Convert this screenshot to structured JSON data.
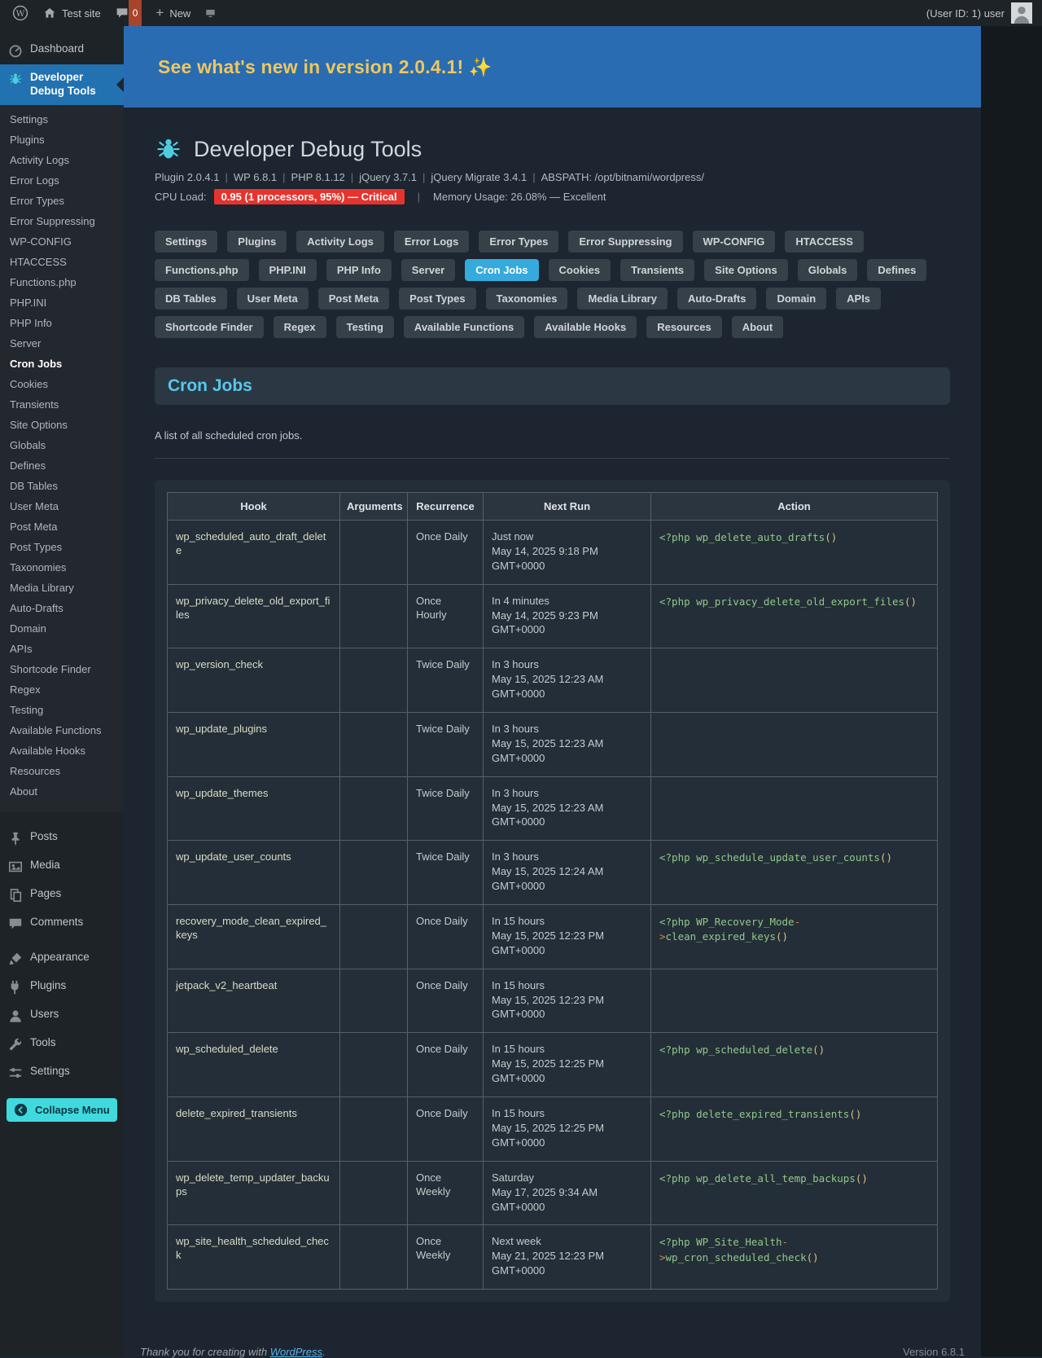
{
  "admin_bar": {
    "site_name": "Test site",
    "comments_count": "0",
    "new_label": "New",
    "user_info": "(User ID: 1) user"
  },
  "sidebar": {
    "dashboard_label": "Dashboard",
    "plugin_label": "Developer Debug Tools",
    "submenu_active": "Cron Jobs",
    "submenu": [
      "Settings",
      "Plugins",
      "Activity Logs",
      "Error Logs",
      "Error Types",
      "Error Suppressing",
      "WP-CONFIG",
      "HTACCESS",
      "Functions.php",
      "PHP.INI",
      "PHP Info",
      "Server",
      "Cron Jobs",
      "Cookies",
      "Transients",
      "Site Options",
      "Globals",
      "Defines",
      "DB Tables",
      "User Meta",
      "Post Meta",
      "Post Types",
      "Taxonomies",
      "Media Library",
      "Auto-Drafts",
      "Domain",
      "APIs",
      "Shortcode Finder",
      "Regex",
      "Testing",
      "Available Functions",
      "Available Hooks",
      "Resources",
      "About"
    ],
    "menu_bottom": [
      "Posts",
      "Media",
      "Pages",
      "Comments",
      "Appearance",
      "Plugins",
      "Users",
      "Tools",
      "Settings"
    ],
    "collapse_label": "Collapse Menu"
  },
  "banner": {
    "text": "See what's new in version 2.0.4.1! ✨"
  },
  "header": {
    "title": "Developer Debug Tools",
    "meta_items": [
      "Plugin 2.0.4.1",
      "WP 6.8.1",
      "PHP 8.1.12",
      "jQuery 3.7.1",
      "jQuery Migrate 3.4.1",
      "ABSPATH: /opt/bitnami/wordpress/"
    ],
    "cpu_label": "CPU Load:",
    "cpu_badge": "0.95 (1 processors, 95%) — Critical",
    "memory_separator": "|",
    "memory_text": "Memory Usage: 26.08% — Excellent"
  },
  "tabs": {
    "active": "Cron Jobs",
    "items": [
      "Settings",
      "Plugins",
      "Activity Logs",
      "Error Logs",
      "Error Types",
      "Error Suppressing",
      "WP-CONFIG",
      "HTACCESS",
      "Functions.php",
      "PHP.INI",
      "PHP Info",
      "Server",
      "Cron Jobs",
      "Cookies",
      "Transients",
      "Site Options",
      "Globals",
      "Defines",
      "DB Tables",
      "User Meta",
      "Post Meta",
      "Post Types",
      "Taxonomies",
      "Media Library",
      "Auto-Drafts",
      "Domain",
      "APIs",
      "Shortcode Finder",
      "Regex",
      "Testing",
      "Available Functions",
      "Available Hooks",
      "Resources",
      "About"
    ]
  },
  "section": {
    "title": "Cron Jobs",
    "description": "A list of all scheduled cron jobs."
  },
  "cron_table": {
    "columns": [
      "Hook",
      "Arguments",
      "Recurrence",
      "Next Run",
      "Action"
    ],
    "rows": [
      {
        "hook": "wp_scheduled_auto_draft_delete",
        "arguments": "",
        "recurrence": "Once Daily",
        "next_run": [
          "Just now",
          "May 14, 2025 9:18 PM",
          "GMT+0000"
        ],
        "action": "<?php wp_delete_auto_drafts()"
      },
      {
        "hook": "wp_privacy_delete_old_export_files",
        "arguments": "",
        "recurrence": "Once Hourly",
        "next_run": [
          "In 4 minutes",
          "May 14, 2025 9:23 PM",
          "GMT+0000"
        ],
        "action": "<?php wp_privacy_delete_old_export_files()"
      },
      {
        "hook": "wp_version_check",
        "arguments": "",
        "recurrence": "Twice Daily",
        "next_run": [
          "In 3 hours",
          "May 15, 2025 12:23 AM",
          "GMT+0000"
        ],
        "action": ""
      },
      {
        "hook": "wp_update_plugins",
        "arguments": "",
        "recurrence": "Twice Daily",
        "next_run": [
          "In 3 hours",
          "May 15, 2025 12:23 AM",
          "GMT+0000"
        ],
        "action": ""
      },
      {
        "hook": "wp_update_themes",
        "arguments": "",
        "recurrence": "Twice Daily",
        "next_run": [
          "In 3 hours",
          "May 15, 2025 12:23 AM",
          "GMT+0000"
        ],
        "action": ""
      },
      {
        "hook": "wp_update_user_counts",
        "arguments": "",
        "recurrence": "Twice Daily",
        "next_run": [
          "In 3 hours",
          "May 15, 2025 12:24 AM",
          "GMT+0000"
        ],
        "action": "<?php wp_schedule_update_user_counts()"
      },
      {
        "hook": "recovery_mode_clean_expired_keys",
        "arguments": "",
        "recurrence": "Once Daily",
        "next_run": [
          "In 15 hours",
          "May 15, 2025 12:23 PM",
          "GMT+0000"
        ],
        "action": "<?php WP_Recovery_Mode->clean_expired_keys()"
      },
      {
        "hook": "jetpack_v2_heartbeat",
        "arguments": "",
        "recurrence": "Once Daily",
        "next_run": [
          "In 15 hours",
          "May 15, 2025 12:23 PM",
          "GMT+0000"
        ],
        "action": ""
      },
      {
        "hook": "wp_scheduled_delete",
        "arguments": "",
        "recurrence": "Once Daily",
        "next_run": [
          "In 15 hours",
          "May 15, 2025 12:25 PM",
          "GMT+0000"
        ],
        "action": "<?php wp_scheduled_delete()"
      },
      {
        "hook": "delete_expired_transients",
        "arguments": "",
        "recurrence": "Once Daily",
        "next_run": [
          "In 15 hours",
          "May 15, 2025 12:25 PM",
          "GMT+0000"
        ],
        "action": "<?php delete_expired_transients()"
      },
      {
        "hook": "wp_delete_temp_updater_backups",
        "arguments": "",
        "recurrence": "Once Weekly",
        "next_run": [
          "Saturday",
          "May 17, 2025 9:34 AM",
          "GMT+0000"
        ],
        "action": "<?php wp_delete_all_temp_backups()"
      },
      {
        "hook": "wp_site_health_scheduled_check",
        "arguments": "",
        "recurrence": "Once Weekly",
        "next_run": [
          "Next week",
          "May 21, 2025 12:23 PM",
          "GMT+0000"
        ],
        "action": "<?php WP_Site_Health->wp_cron_scheduled_check()"
      }
    ]
  },
  "footer": {
    "thanks_prefix": "Thank you for creating with ",
    "link": "WordPress",
    "suffix": ".",
    "version": "Version 6.8.1"
  },
  "icons": {
    "wp_logo": "circled-W",
    "home": "house-shape",
    "comments_bubble": "speech-bubble",
    "plus": "+",
    "screen": "monitor-shape",
    "bug": "cyan-spider-bug",
    "collapse": "circle-left-arrow"
  },
  "colors": {
    "banner_blue": "#2a6cb1",
    "menu_active_blue": "#2271b1",
    "accent_cyan": "#57c8ea",
    "active_tab": "#35aadc",
    "cpu_badge_red": "#e5342e",
    "collapse_teal": "#40d9de",
    "banner_text_gold": "#eec75f",
    "code_green": "#8fc987",
    "hook_text": "#d8dbc4"
  }
}
